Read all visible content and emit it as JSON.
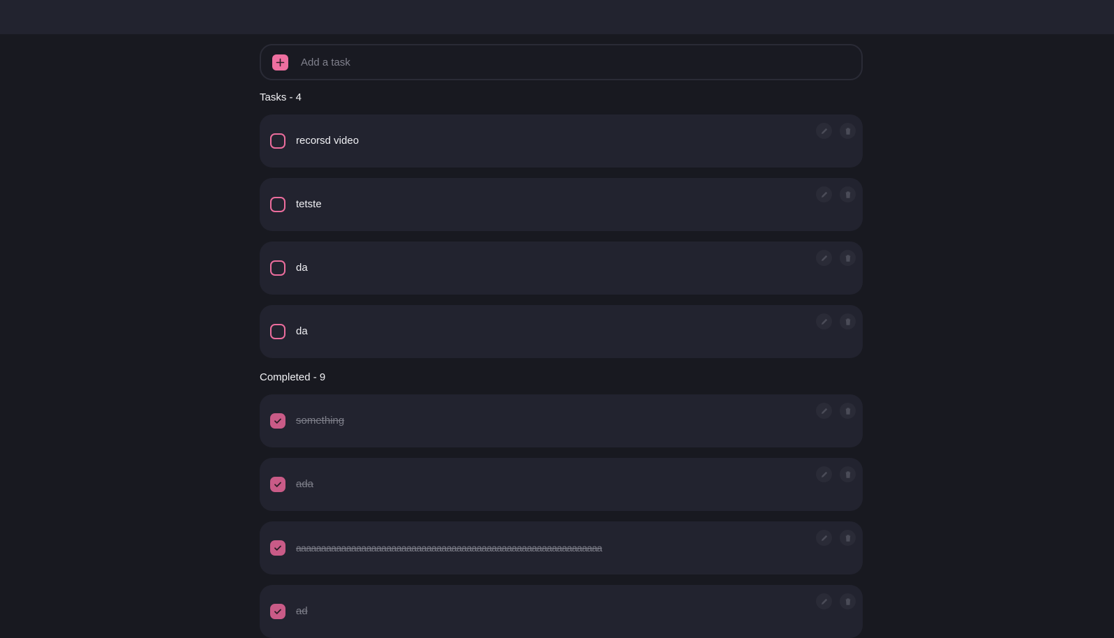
{
  "add_task": {
    "placeholder": "Add a task"
  },
  "tasks_section": {
    "title": "Tasks - 4",
    "items": [
      {
        "text": "recorsd video"
      },
      {
        "text": "tetste"
      },
      {
        "text": "da"
      },
      {
        "text": "da"
      }
    ]
  },
  "completed_section": {
    "title": "Completed - 9",
    "items": [
      {
        "text": "something"
      },
      {
        "text": "ada"
      },
      {
        "text": "aaaaaaaaaaaaaaaaaaaaaaaaaaaaaaaaaaaaaaaaaaaaaaaaaaaaaaaaaaaaa"
      },
      {
        "text": "ad"
      }
    ]
  },
  "colors": {
    "accent": "#ee6fa0",
    "checked": "#c95b87",
    "background": "#181920",
    "card": "#22232f"
  },
  "icons": {
    "add": "plus-icon",
    "edit": "pencil-icon",
    "delete": "trash-icon",
    "check": "check-icon"
  }
}
